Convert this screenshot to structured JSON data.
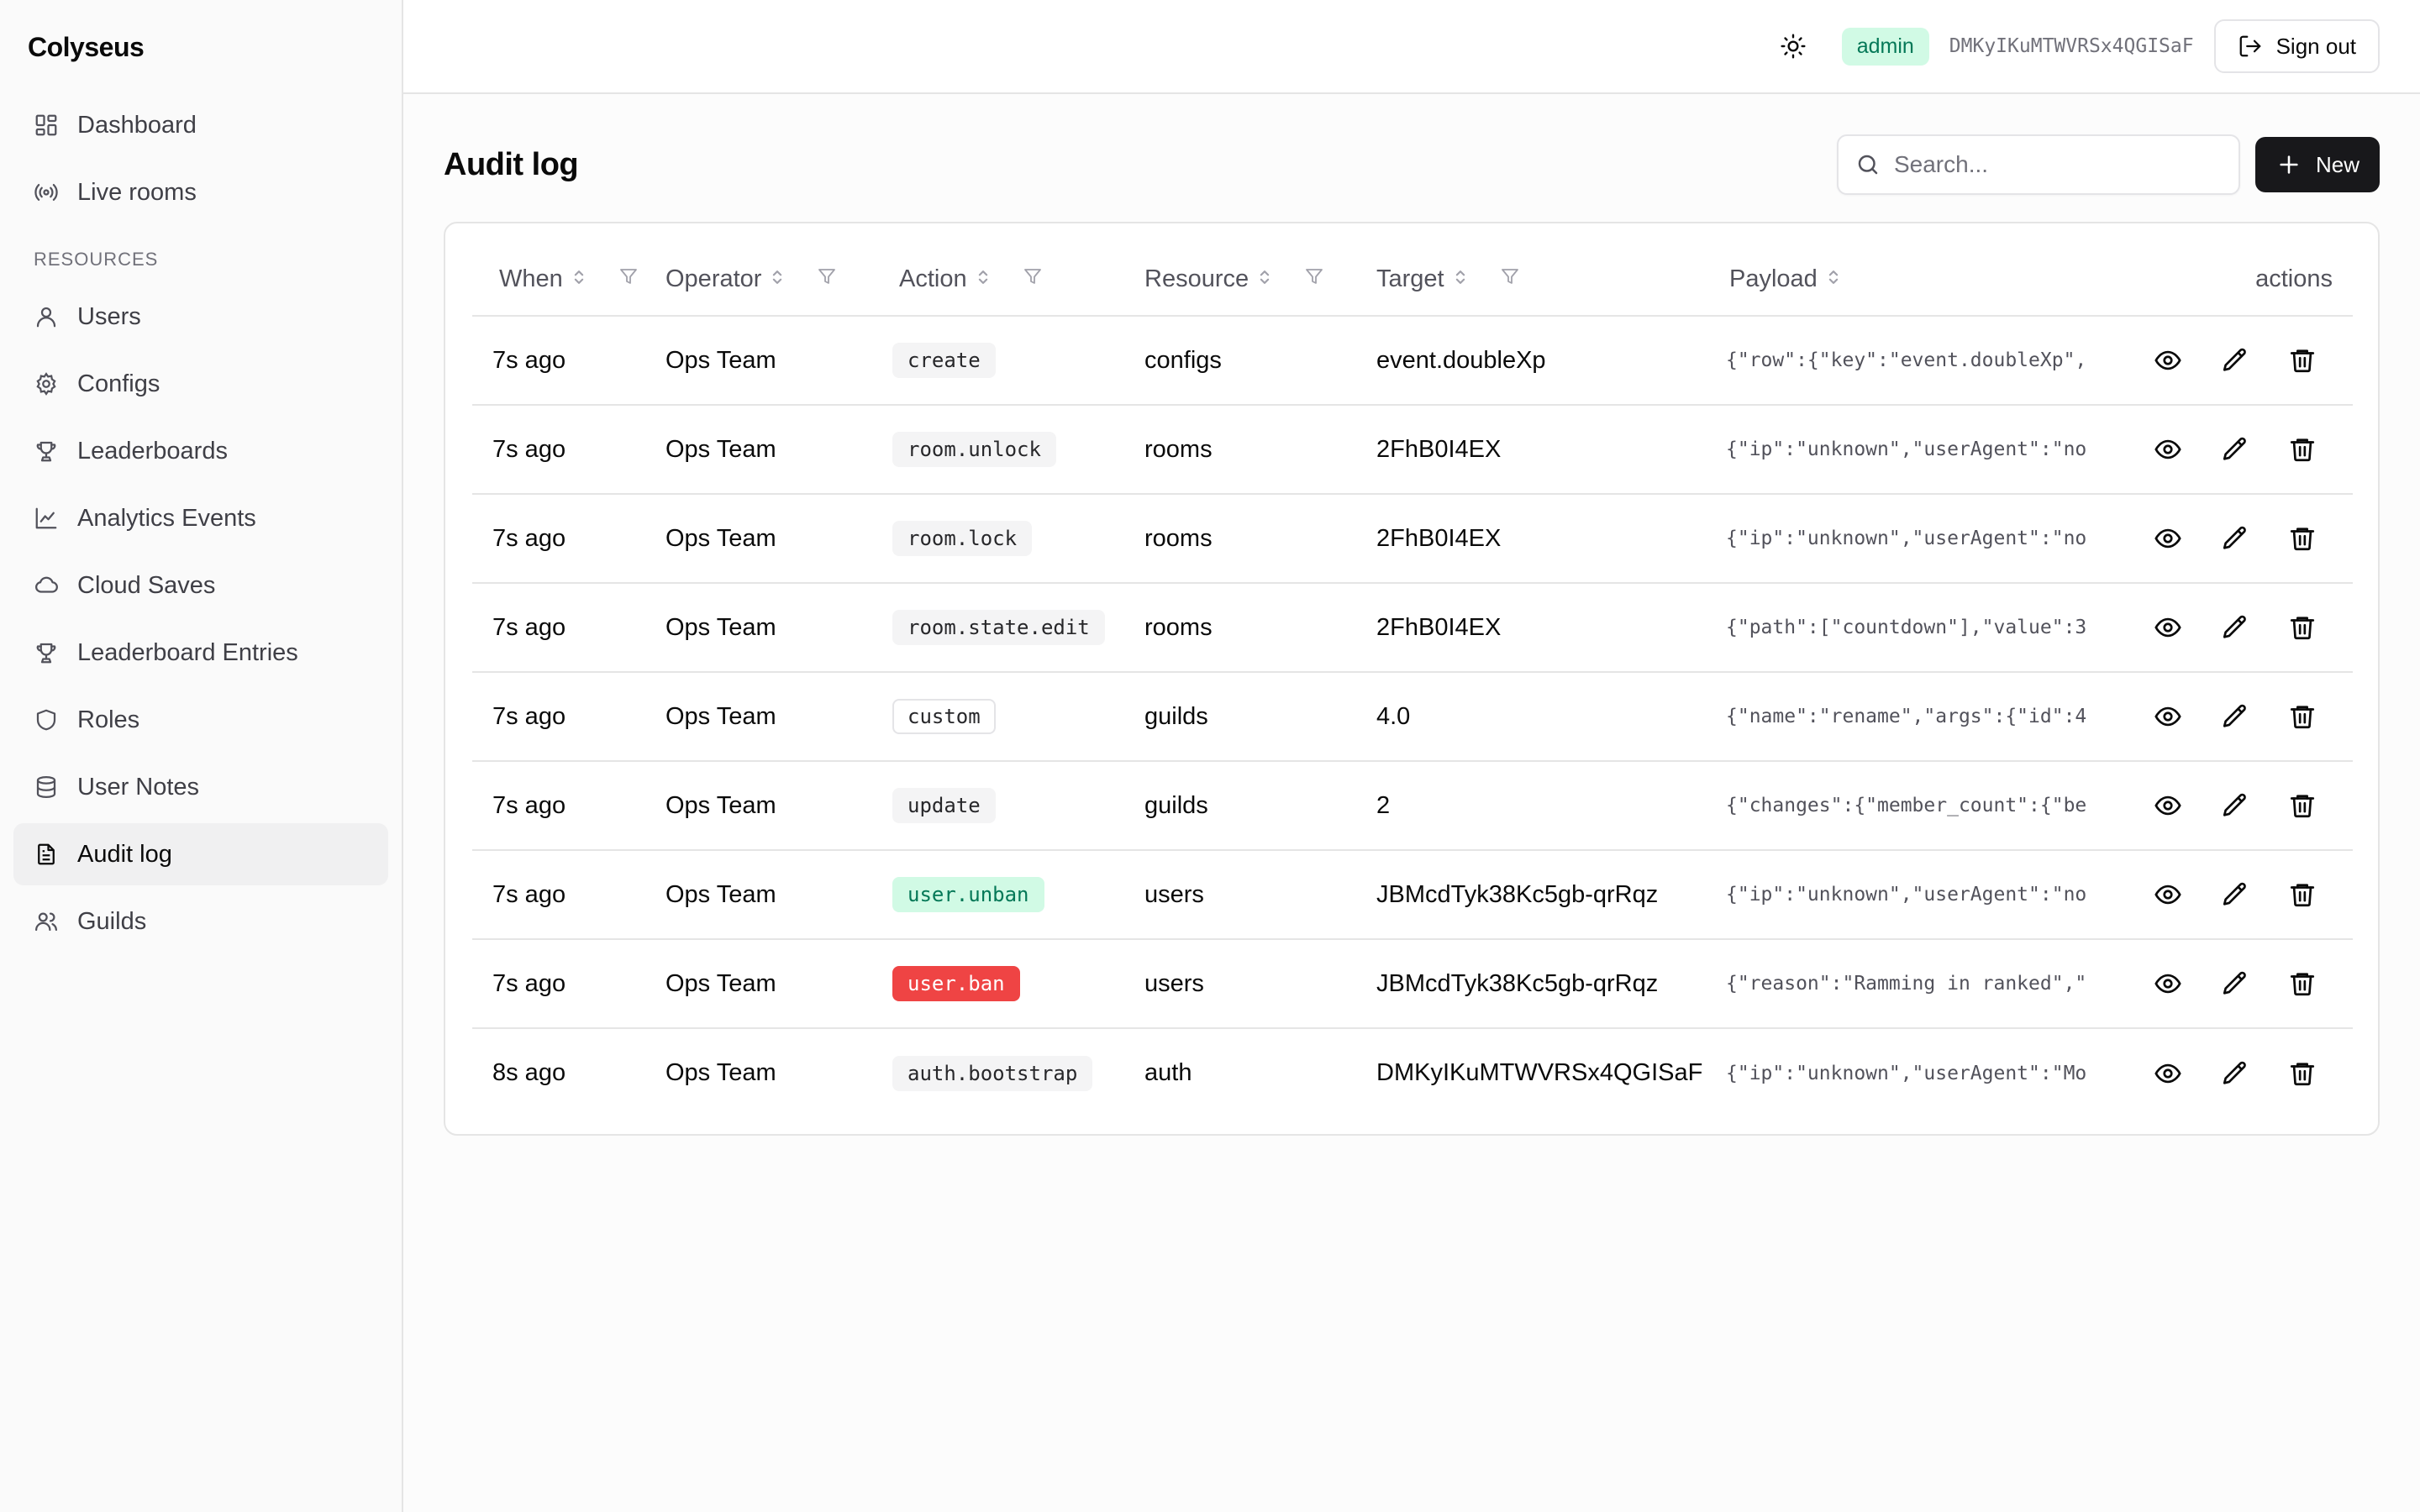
{
  "app": {
    "brand": "Colyseus"
  },
  "sidebar": {
    "top_items": [
      {
        "label": "Dashboard",
        "icon": "dashboard-icon"
      },
      {
        "label": "Live rooms",
        "icon": "broadcast-icon"
      }
    ],
    "section_label": "RESOURCES",
    "items": [
      {
        "label": "Users",
        "icon": "user-icon"
      },
      {
        "label": "Configs",
        "icon": "gear-icon"
      },
      {
        "label": "Leaderboards",
        "icon": "trophy-icon"
      },
      {
        "label": "Analytics Events",
        "icon": "line-chart-icon"
      },
      {
        "label": "Cloud Saves",
        "icon": "cloud-icon"
      },
      {
        "label": "Leaderboard Entries",
        "icon": "trophy-icon"
      },
      {
        "label": "Roles",
        "icon": "shield-icon"
      },
      {
        "label": "User Notes",
        "icon": "database-icon"
      },
      {
        "label": "Audit log",
        "icon": "document-icon",
        "active": true
      },
      {
        "label": "Guilds",
        "icon": "users-icon"
      }
    ]
  },
  "topbar": {
    "role": "admin",
    "user_id": "DMKyIKuMTWVRSx4QGISaF",
    "sign_out_label": "Sign out"
  },
  "page": {
    "title": "Audit log",
    "search_placeholder": "Search...",
    "new_label": "New"
  },
  "table": {
    "columns": {
      "when": "When",
      "operator": "Operator",
      "action": "Action",
      "resource": "Resource",
      "target": "Target",
      "payload": "Payload",
      "actions": "actions"
    },
    "rows": [
      {
        "when": "7s ago",
        "operator": "Ops Team",
        "action": "create",
        "action_style": "gray",
        "resource": "configs",
        "target": "event.doubleXp",
        "payload": "{\"row\":{\"key\":\"event.doubleXp\","
      },
      {
        "when": "7s ago",
        "operator": "Ops Team",
        "action": "room.unlock",
        "action_style": "gray",
        "resource": "rooms",
        "target": "2FhB0I4EX",
        "payload": "{\"ip\":\"unknown\",\"userAgent\":\"no"
      },
      {
        "when": "7s ago",
        "operator": "Ops Team",
        "action": "room.lock",
        "action_style": "gray",
        "resource": "rooms",
        "target": "2FhB0I4EX",
        "payload": "{\"ip\":\"unknown\",\"userAgent\":\"no"
      },
      {
        "when": "7s ago",
        "operator": "Ops Team",
        "action": "room.state.edit",
        "action_style": "gray",
        "resource": "rooms",
        "target": "2FhB0I4EX",
        "payload": "{\"path\":[\"countdown\"],\"value\":3"
      },
      {
        "when": "7s ago",
        "operator": "Ops Team",
        "action": "custom",
        "action_style": "outline",
        "resource": "guilds",
        "target": "4.0",
        "payload": "{\"name\":\"rename\",\"args\":{\"id\":4"
      },
      {
        "when": "7s ago",
        "operator": "Ops Team",
        "action": "update",
        "action_style": "gray",
        "resource": "guilds",
        "target": "2",
        "payload": "{\"changes\":{\"member_count\":{\"be"
      },
      {
        "when": "7s ago",
        "operator": "Ops Team",
        "action": "user.unban",
        "action_style": "green",
        "resource": "users",
        "target": "JBMcdTyk38Kc5gb-qrRqz",
        "payload": "{\"ip\":\"unknown\",\"userAgent\":\"no"
      },
      {
        "when": "7s ago",
        "operator": "Ops Team",
        "action": "user.ban",
        "action_style": "red",
        "resource": "users",
        "target": "JBMcdTyk38Kc5gb-qrRqz",
        "payload": "{\"reason\":\"Ramming in ranked\",\""
      },
      {
        "when": "8s ago",
        "operator": "Ops Team",
        "action": "auth.bootstrap",
        "action_style": "gray",
        "resource": "auth",
        "target": "DMKyIKuMTWVRSx4QGISaF",
        "payload": "{\"ip\":\"unknown\",\"userAgent\":\"Mo"
      }
    ]
  },
  "colors": {
    "accent_green_bg": "#d1fae5",
    "accent_green_text": "#047857",
    "danger": "#ef4444",
    "primary": "#18181b"
  }
}
